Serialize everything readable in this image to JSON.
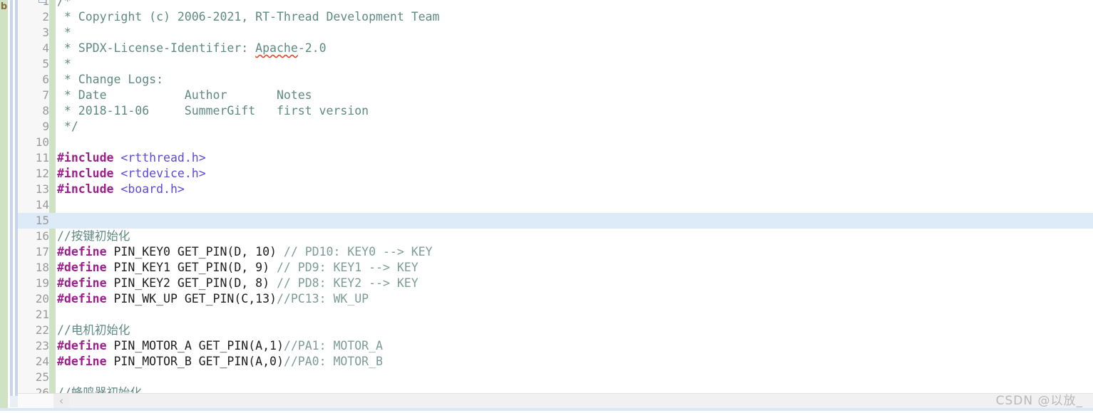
{
  "window": {
    "tool_tab_label": "b",
    "watermark": "CSDN @以放_"
  },
  "scrollbar": {
    "left_arrow": "‹"
  },
  "editor": {
    "language": "c",
    "caret_line": 15,
    "first_visible_line": 1,
    "last_visible_line": 26,
    "colors": {
      "background": "#ffffff",
      "gutter_background": "#f7f7f7",
      "change_bar": "#cfe3c4",
      "caret_line_highlight": "#ddeaf7",
      "line_number": "#9a9a9a",
      "comment": "#5f8a82",
      "preprocessor": "#9c1e8c",
      "header_include": "#5b4bd6",
      "plain_text": "#202020",
      "spellcheck_underline": "#e04b2a",
      "tool_strip": "#cfe3c4",
      "divider_strip": "#c8d4ea"
    },
    "lines": [
      {
        "n": "1",
        "folded": true,
        "tokens": [
          {
            "t": "/*",
            "c": "comment"
          }
        ]
      },
      {
        "n": "2",
        "tokens": [
          {
            "t": " * Copyright (c) 2006-2021, RT-Thread Development Team",
            "c": "comment"
          }
        ]
      },
      {
        "n": "3",
        "tokens": [
          {
            "t": " *",
            "c": "comment"
          }
        ]
      },
      {
        "n": "4",
        "tokens": [
          {
            "t": " * SPDX-License-Identifier: ",
            "c": "comment"
          },
          {
            "t": "Apache",
            "c": "comment spell"
          },
          {
            "t": "-2.0",
            "c": "comment"
          }
        ]
      },
      {
        "n": "5",
        "tokens": [
          {
            "t": " *",
            "c": "comment"
          }
        ]
      },
      {
        "n": "6",
        "tokens": [
          {
            "t": " * Change Logs:",
            "c": "comment"
          }
        ]
      },
      {
        "n": "7",
        "tokens": [
          {
            "t": " * Date           Author       Notes",
            "c": "comment"
          }
        ]
      },
      {
        "n": "8",
        "tokens": [
          {
            "t": " * 2018-11-06     SummerGift   first version",
            "c": "comment"
          }
        ]
      },
      {
        "n": "9",
        "tokens": [
          {
            "t": " */",
            "c": "comment"
          }
        ]
      },
      {
        "n": "10",
        "tokens": []
      },
      {
        "n": "11",
        "tokens": [
          {
            "t": "#include",
            "c": "pp"
          },
          {
            "t": " ",
            "c": "plain"
          },
          {
            "t": "<rtthread.h>",
            "c": "header"
          }
        ]
      },
      {
        "n": "12",
        "tokens": [
          {
            "t": "#include",
            "c": "pp"
          },
          {
            "t": " ",
            "c": "plain"
          },
          {
            "t": "<rtdevice.h>",
            "c": "header"
          }
        ]
      },
      {
        "n": "13",
        "tokens": [
          {
            "t": "#include",
            "c": "pp"
          },
          {
            "t": " ",
            "c": "plain"
          },
          {
            "t": "<board.h>",
            "c": "header"
          }
        ]
      },
      {
        "n": "14",
        "tokens": []
      },
      {
        "n": "15",
        "caret": true,
        "tokens": []
      },
      {
        "n": "16",
        "tokens": [
          {
            "t": "//按键初始化",
            "c": "comment"
          }
        ]
      },
      {
        "n": "17",
        "tokens": [
          {
            "t": "#define",
            "c": "pp"
          },
          {
            "t": " PIN_KEY0 GET_PIN(D, 10) ",
            "c": "plain"
          },
          {
            "t": "// PD10: KEY0 --> KEY",
            "c": "comment2"
          }
        ]
      },
      {
        "n": "18",
        "tokens": [
          {
            "t": "#define",
            "c": "pp"
          },
          {
            "t": " PIN_KEY1 GET_PIN(D, 9) ",
            "c": "plain"
          },
          {
            "t": "// PD9: KEY1 --> KEY",
            "c": "comment2"
          }
        ]
      },
      {
        "n": "19",
        "tokens": [
          {
            "t": "#define",
            "c": "pp"
          },
          {
            "t": " PIN_KEY2 GET_PIN(D, 8) ",
            "c": "plain"
          },
          {
            "t": "// PD8: KEY2 --> KEY",
            "c": "comment2"
          }
        ]
      },
      {
        "n": "20",
        "tokens": [
          {
            "t": "#define",
            "c": "pp"
          },
          {
            "t": " PIN_WK_UP GET_PIN(C,13)",
            "c": "plain"
          },
          {
            "t": "//PC13: WK_UP",
            "c": "comment2"
          }
        ]
      },
      {
        "n": "21",
        "tokens": []
      },
      {
        "n": "22",
        "tokens": [
          {
            "t": "//电机初始化",
            "c": "comment"
          }
        ]
      },
      {
        "n": "23",
        "tokens": [
          {
            "t": "#define",
            "c": "pp"
          },
          {
            "t": " PIN_MOTOR_A GET_PIN(A,1)",
            "c": "plain"
          },
          {
            "t": "//PA1: MOTOR_A",
            "c": "comment2"
          }
        ]
      },
      {
        "n": "24",
        "tokens": [
          {
            "t": "#define",
            "c": "pp"
          },
          {
            "t": " PIN_MOTOR_B GET_PIN(A,0)",
            "c": "plain"
          },
          {
            "t": "//PA0: MOTOR_B",
            "c": "comment2"
          }
        ]
      },
      {
        "n": "25",
        "tokens": []
      },
      {
        "n": "26",
        "tokens": [
          {
            "t": "//蜂鸣器初始化",
            "c": "comment"
          }
        ]
      }
    ]
  }
}
